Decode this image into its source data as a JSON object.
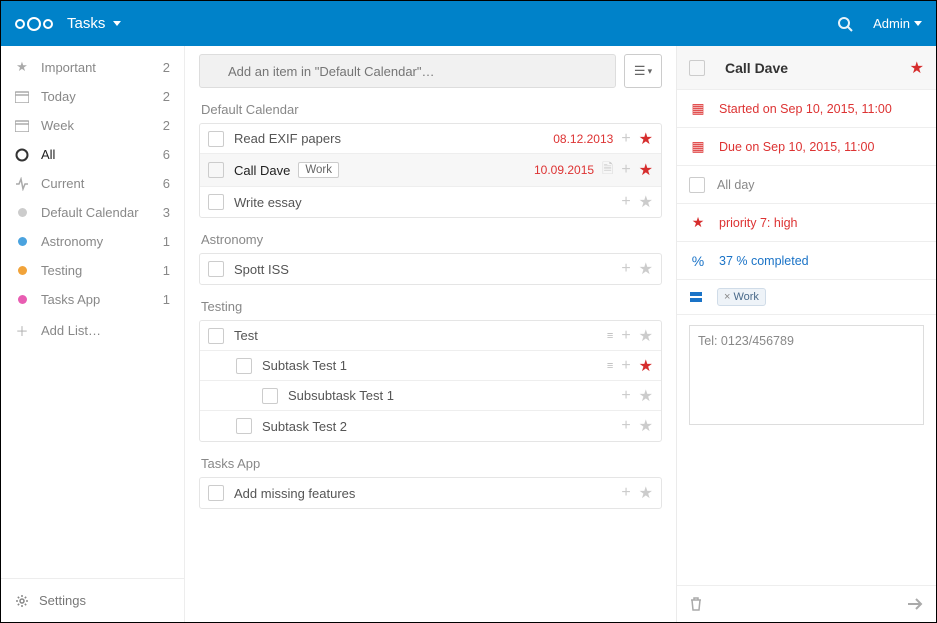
{
  "header": {
    "app_name": "Tasks",
    "user": "Admin"
  },
  "sidebar": {
    "smart": [
      {
        "label": "Important",
        "count": 2
      },
      {
        "label": "Today",
        "count": 2
      },
      {
        "label": "Week",
        "count": 2
      },
      {
        "label": "All",
        "count": 6
      },
      {
        "label": "Current",
        "count": 6
      }
    ],
    "calendars": [
      {
        "label": "Default Calendar",
        "count": 3,
        "color": "#cccccc"
      },
      {
        "label": "Astronomy",
        "count": 1,
        "color": "#4aa3df"
      },
      {
        "label": "Testing",
        "count": 1,
        "color": "#f1a33a"
      },
      {
        "label": "Tasks App",
        "count": 1,
        "color": "#e85db2"
      }
    ],
    "add_list": "Add List…",
    "settings": "Settings"
  },
  "main": {
    "add_placeholder": "Add an item in \"Default Calendar\"…",
    "sections": [
      {
        "title": "Default Calendar",
        "tasks": [
          {
            "title": "Read EXIF papers",
            "date": "08.12.2013",
            "starred": true
          },
          {
            "title": "Call Dave",
            "tag": "Work",
            "date": "10.09.2015",
            "has_note": true,
            "starred": true,
            "selected": true
          },
          {
            "title": "Write essay"
          }
        ]
      },
      {
        "title": "Astronomy",
        "tasks": [
          {
            "title": "Spott ISS"
          }
        ]
      },
      {
        "title": "Testing",
        "tasks": [
          {
            "title": "Test",
            "sortable": true
          },
          {
            "title": "Subtask Test 1",
            "indent": 1,
            "starred": true,
            "sortable": true
          },
          {
            "title": "Subsubtask Test 1",
            "indent": 2
          },
          {
            "title": "Subtask Test 2",
            "indent": 1
          }
        ]
      },
      {
        "title": "Tasks App",
        "tasks": [
          {
            "title": "Add missing features"
          }
        ]
      }
    ]
  },
  "detail": {
    "title": "Call Dave",
    "starred": true,
    "start": "Started on Sep 10, 2015, 11:00",
    "due": "Due on Sep 10, 2015, 11:00",
    "allday": "All day",
    "priority": "priority 7: high",
    "completed": "37 % completed",
    "tag": "Work",
    "notes": "Tel: 0123/456789"
  }
}
